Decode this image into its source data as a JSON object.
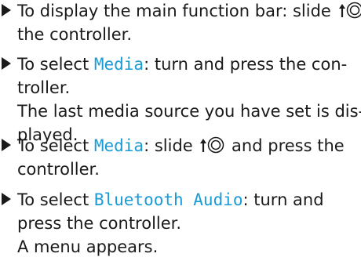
{
  "steps": [
    {
      "l1_pre": "To display the main function bar: slide ",
      "l2": "the controller."
    },
    {
      "l1_pre": "To select ",
      "l1_ui": "Media",
      "l1_post": ": turn and press the con-",
      "l2": "troller.",
      "l3": "The last media source you have set is dis-",
      "l4": "played."
    },
    {
      "l1_pre": "To select ",
      "l1_ui": "Media",
      "l1_post": ": slide ",
      "l1_post2": " and press the",
      "l2": "controller."
    },
    {
      "l1_pre": "To select ",
      "l1_ui": "Bluetooth Audio",
      "l1_post": ": turn and",
      "l2": "press the controller.",
      "l3": "A menu appears."
    }
  ],
  "colors": {
    "text": "#1a1a1a",
    "ui_highlight": "#1a9bd6"
  },
  "icons": [
    "arrow-bullet-icon",
    "controller-slide-up-icon"
  ]
}
